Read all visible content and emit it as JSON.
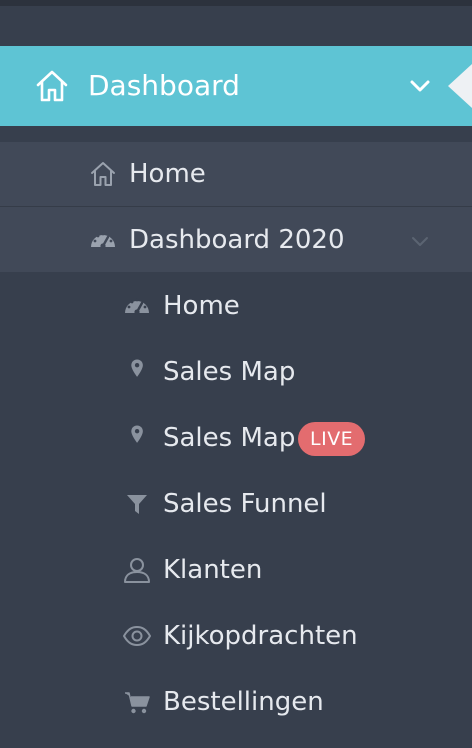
{
  "active": {
    "label": "Dashboard",
    "icon": "home-icon"
  },
  "menu": {
    "home": {
      "label": "Home",
      "icon": "home-icon"
    },
    "dashboard2020": {
      "label": "Dashboard 2020",
      "icon": "speedometer-icon"
    }
  },
  "submenu": {
    "items": [
      {
        "label": "Home",
        "icon": "speedometer-icon"
      },
      {
        "label": "Sales Map",
        "icon": "map-pin-icon"
      },
      {
        "label": "Sales Map",
        "icon": "map-pin-icon",
        "badge": "LIVE"
      },
      {
        "label": "Sales Funnel",
        "icon": "funnel-icon"
      },
      {
        "label": "Klanten",
        "icon": "user-icon"
      },
      {
        "label": "Kijkopdrachten",
        "icon": "eye-icon"
      },
      {
        "label": "Bestellingen",
        "icon": "cart-icon"
      }
    ]
  },
  "colors": {
    "accent": "#5ec4d4",
    "background": "#373f4d",
    "badge": "#e36c6f"
  }
}
